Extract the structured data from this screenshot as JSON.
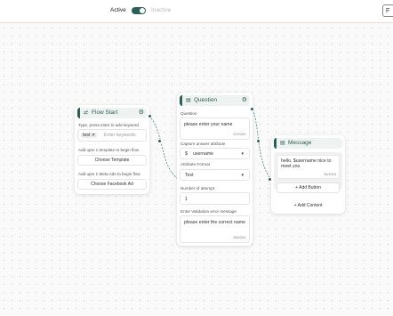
{
  "topbar": {
    "active_label": "Active",
    "inactive_label": "Inactive",
    "right_button": "F"
  },
  "flow_start": {
    "title": "Flow Start",
    "keyword_label": "Type, press enter to add keyword",
    "chip": "test",
    "keyword_placeholder": "Enter keywords",
    "template_label": "Add upto 1 template to begin flow",
    "template_button": "Choose Template",
    "meta_label": "Add upto 1 Meta Ads to begin flow",
    "meta_button": "Choose Facebook Ad"
  },
  "question": {
    "title": "Question",
    "question_label": "Question",
    "question_text": "please enter your name",
    "question_count": "22/1024",
    "capture_label": "Capture answer attribute",
    "capture_prefix": "$",
    "capture_value": "username",
    "format_label": "Attribute Format",
    "format_value": "Text",
    "attempt_label": "Number of attempt",
    "attempt_value": "1",
    "error_label": "Enter Validation error message",
    "error_text": "please enter the correct name",
    "error_count": "28/1024"
  },
  "message": {
    "title": "Message",
    "bubble_text": "hello, $username nice to meet you",
    "bubble_count": "34/1024",
    "add_button": "+ Add Button",
    "add_content": "+ Add Content"
  },
  "colors": {
    "accent": "#2c5f56",
    "header_bg": "#eef2f1",
    "canvas": "#fafafa"
  }
}
